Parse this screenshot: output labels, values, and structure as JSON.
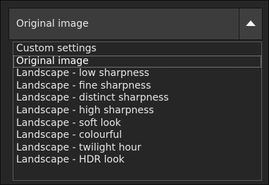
{
  "select": {
    "value": "Original image",
    "arrow_icon": "triangle-up-icon"
  },
  "dropdown": {
    "selected_index": 1,
    "items": [
      {
        "label": "Custom settings"
      },
      {
        "label": "Original image"
      },
      {
        "label": "Landscape - low sharpness"
      },
      {
        "label": "Landscape - fine sharpness"
      },
      {
        "label": "Landscape - distinct sharpness"
      },
      {
        "label": "Landscape - high sharpness"
      },
      {
        "label": "Landscape - soft look"
      },
      {
        "label": "Landscape - colourful"
      },
      {
        "label": "Landscape - twilight hour"
      },
      {
        "label": "Landscape - HDR look"
      }
    ]
  },
  "colors": {
    "background": "#262626",
    "select_face": "#3c3c3c",
    "text": "#e6e6e6",
    "list_border": "#5a5a5a"
  }
}
